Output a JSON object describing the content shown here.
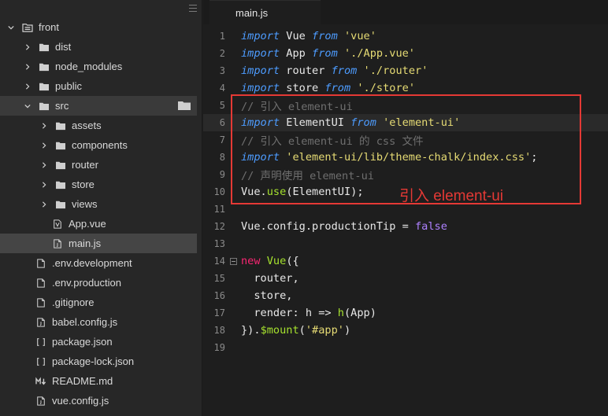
{
  "sidebar": {
    "root": {
      "label": "front",
      "icon": "folder-open-icon",
      "state": "expanded"
    },
    "items": [
      {
        "label": "dist",
        "type": "folder",
        "state": "collapsed",
        "depth": 1
      },
      {
        "label": "node_modules",
        "type": "folder",
        "state": "collapsed",
        "depth": 1
      },
      {
        "label": "public",
        "type": "folder",
        "state": "collapsed",
        "depth": 1
      },
      {
        "label": "src",
        "type": "folder",
        "state": "expanded",
        "depth": 1
      },
      {
        "label": "assets",
        "type": "folder",
        "state": "collapsed",
        "depth": 2
      },
      {
        "label": "components",
        "type": "folder",
        "state": "collapsed",
        "depth": 2
      },
      {
        "label": "router",
        "type": "folder",
        "state": "collapsed",
        "depth": 2
      },
      {
        "label": "store",
        "type": "folder",
        "state": "collapsed",
        "depth": 2
      },
      {
        "label": "views",
        "type": "folder",
        "state": "collapsed",
        "depth": 2
      },
      {
        "label": "App.vue",
        "type": "file",
        "icon": "vue-file-icon",
        "depth": 2
      },
      {
        "label": "main.js",
        "type": "file",
        "icon": "js-file-icon",
        "depth": 2,
        "selected": true
      },
      {
        "label": ".env.development",
        "type": "file",
        "icon": "file-icon",
        "depth": 1
      },
      {
        "label": ".env.production",
        "type": "file",
        "icon": "file-icon",
        "depth": 1
      },
      {
        "label": ".gitignore",
        "type": "file",
        "icon": "file-icon",
        "depth": 1
      },
      {
        "label": "babel.config.js",
        "type": "file",
        "icon": "js-file-icon",
        "depth": 1
      },
      {
        "label": "package.json",
        "type": "file",
        "icon": "json-file-icon",
        "depth": 1
      },
      {
        "label": "package-lock.json",
        "type": "file",
        "icon": "json-file-icon",
        "depth": 1
      },
      {
        "label": "README.md",
        "type": "file",
        "icon": "markdown-file-icon",
        "depth": 1
      },
      {
        "label": "vue.config.js",
        "type": "file",
        "icon": "js-file-icon",
        "depth": 1
      }
    ]
  },
  "tabs": [
    {
      "label": "main.js",
      "active": true
    }
  ],
  "editor": {
    "active_line": 6,
    "lines": [
      [
        [
          "kw",
          "import"
        ],
        [
          "p",
          " Vue "
        ],
        [
          "kw",
          "from"
        ],
        [
          "p",
          " "
        ],
        [
          "str",
          "'vue'"
        ]
      ],
      [
        [
          "kw",
          "import"
        ],
        [
          "p",
          " App "
        ],
        [
          "kw",
          "from"
        ],
        [
          "p",
          " "
        ],
        [
          "str",
          "'./App.vue'"
        ]
      ],
      [
        [
          "kw",
          "import"
        ],
        [
          "p",
          " router "
        ],
        [
          "kw",
          "from"
        ],
        [
          "p",
          " "
        ],
        [
          "str",
          "'./router'"
        ]
      ],
      [
        [
          "kw",
          "import"
        ],
        [
          "p",
          " store "
        ],
        [
          "kw",
          "from"
        ],
        [
          "p",
          " "
        ],
        [
          "str",
          "'./store'"
        ]
      ],
      [
        [
          "cmt",
          "// 引入 element-ui"
        ]
      ],
      [
        [
          "kw",
          "import"
        ],
        [
          "p",
          " ElementUI "
        ],
        [
          "kw",
          "from"
        ],
        [
          "p",
          " "
        ],
        [
          "str",
          "'element-ui'"
        ]
      ],
      [
        [
          "cmt",
          "// 引入 element-ui 的 css 文件"
        ]
      ],
      [
        [
          "kw",
          "import"
        ],
        [
          "p",
          " "
        ],
        [
          "str",
          "'element-ui/lib/theme-chalk/index.css'"
        ],
        [
          "p",
          ";"
        ]
      ],
      [
        [
          "cmt",
          "// 声明使用 element-ui"
        ]
      ],
      [
        [
          "p",
          "Vue."
        ],
        [
          "fn",
          "use"
        ],
        [
          "p",
          "(ElementUI);"
        ]
      ],
      [],
      [
        [
          "p",
          "Vue.config.productionTip = "
        ],
        [
          "const",
          "false"
        ]
      ],
      [],
      [
        [
          "kw2",
          "new"
        ],
        [
          "p",
          " "
        ],
        [
          "fn",
          "Vue"
        ],
        [
          "p",
          "({"
        ]
      ],
      [
        [
          "p",
          "  router,"
        ]
      ],
      [
        [
          "p",
          "  store,"
        ]
      ],
      [
        [
          "p",
          "  render: h => "
        ],
        [
          "fn",
          "h"
        ],
        [
          "p",
          "(App)"
        ]
      ],
      [
        [
          "p",
          "})."
        ],
        [
          "fn",
          "$mount"
        ],
        [
          "p",
          "("
        ],
        [
          "str",
          "'#app'"
        ],
        [
          "p",
          ")"
        ]
      ],
      []
    ]
  },
  "annotation": {
    "text": "引入 element-ui",
    "color": "#e53935"
  },
  "colors": {
    "keyword": "#4d9cff",
    "string": "#e6db74",
    "comment": "#6f6f6f",
    "function": "#a6e22e",
    "constant": "#ae81ff",
    "new_keyword": "#f92672"
  }
}
